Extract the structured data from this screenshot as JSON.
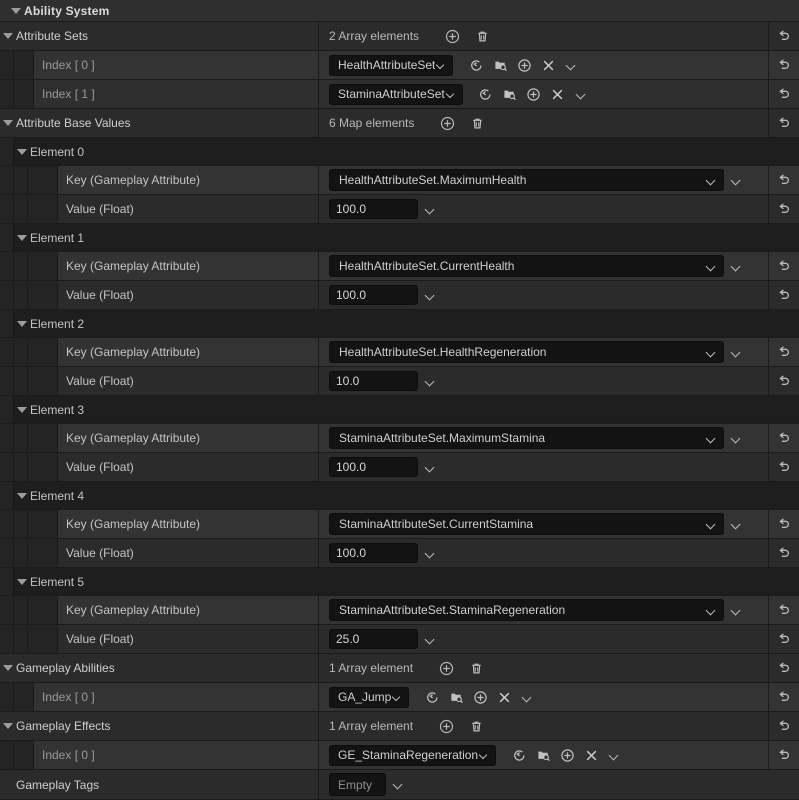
{
  "panel": {
    "root_label": "Ability System",
    "background": "#242424"
  },
  "icons": {
    "expand": "triangle-down-icon",
    "add": "plus-circle-icon",
    "delete": "trash-icon",
    "revert": "revert-arrow-icon",
    "browse_back": "browse-to-asset-icon",
    "browse_content": "browse-content-icon",
    "use_selected": "use-selected-asset-icon",
    "clear": "clear-asset-icon",
    "dropdown": "chevron-down-icon"
  },
  "sections": {
    "attribute_sets": {
      "label": "Attribute Sets",
      "count_text": "2 Array elements",
      "items": [
        {
          "label": "Index [ 0 ]",
          "value": "HealthAttributeSet"
        },
        {
          "label": "Index [ 1 ]",
          "value": "StaminaAttributeSet"
        }
      ]
    },
    "attribute_base_values": {
      "label": "Attribute Base Values",
      "count_text": "6 Map elements",
      "key_label": "Key (Gameplay Attribute)",
      "value_label": "Value (Float)",
      "elements": [
        {
          "label": "Element 0",
          "key": "HealthAttributeSet.MaximumHealth",
          "value": "100.0"
        },
        {
          "label": "Element 1",
          "key": "HealthAttributeSet.CurrentHealth",
          "value": "100.0"
        },
        {
          "label": "Element 2",
          "key": "HealthAttributeSet.HealthRegeneration",
          "value": "10.0"
        },
        {
          "label": "Element 3",
          "key": "StaminaAttributeSet.MaximumStamina",
          "value": "100.0"
        },
        {
          "label": "Element 4",
          "key": "StaminaAttributeSet.CurrentStamina",
          "value": "100.0"
        },
        {
          "label": "Element 5",
          "key": "StaminaAttributeSet.StaminaRegeneration",
          "value": "25.0"
        }
      ]
    },
    "gameplay_abilities": {
      "label": "Gameplay Abilities",
      "count_text": "1 Array element",
      "items": [
        {
          "label": "Index [ 0 ]",
          "value": "GA_Jump"
        }
      ]
    },
    "gameplay_effects": {
      "label": "Gameplay Effects",
      "count_text": "1 Array element",
      "items": [
        {
          "label": "Index [ 0 ]",
          "value": "GE_StaminaRegeneration"
        }
      ]
    },
    "gameplay_tags": {
      "label": "Gameplay Tags",
      "value": "Empty"
    }
  }
}
